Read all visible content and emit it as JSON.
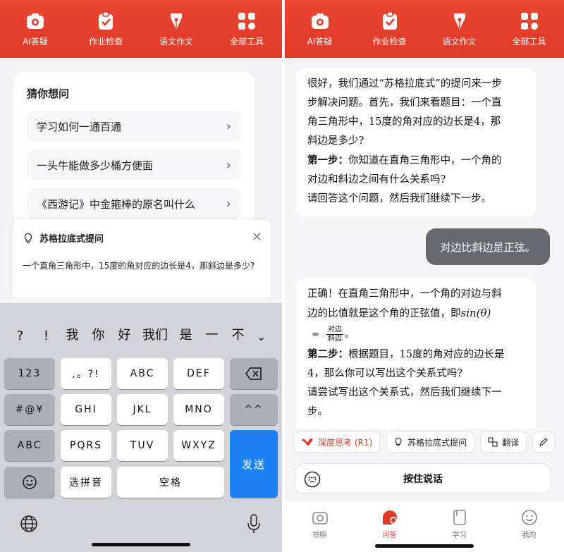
{
  "toolbar": {
    "items": [
      "AI答疑",
      "作业检查",
      "语文作文",
      "全部工具"
    ]
  },
  "left": {
    "guess": {
      "title": "猜你想问",
      "questions": [
        "学习如何一通百通",
        "一头牛能做多少桶方便面",
        "《西游记》中金箍棒的原名叫什么"
      ]
    },
    "socratic_card": {
      "title": "苏格拉底式提问",
      "close": "✕",
      "text": "一个直角三角形中，15度的角对应的边长是4，那斜边是多少?"
    },
    "keyboard": {
      "candidates": [
        "?",
        "!",
        "我",
        "你",
        "好",
        "我们",
        "是",
        "一",
        "不"
      ],
      "row1": [
        ",。?!",
        "ABC",
        "DEF"
      ],
      "row2": [
        "GHI",
        "JKL",
        "MNO"
      ],
      "row3": [
        "PQRS",
        "TUV",
        "WXYZ"
      ],
      "k123": "123",
      "sym": "#@¥",
      "abc": "ABC",
      "face": "^^",
      "pinyin": "选拼音",
      "space": "空格",
      "send": "发送"
    }
  },
  "right": {
    "msg1": {
      "l1": "很好，我们通过“苏格拉底式”的提问来一步",
      "l2": "步解决问题。首先，我们来看题目：一个直",
      "l3": "角三角形中，15度的角对应的边长是4，那",
      "l4": "斜边是多少?",
      "step_label": "第一步：",
      "l5": "你知道在直角三角形中，一个角的",
      "l6": "对边和斜边之间有什么关系吗?",
      "l7": "请回答这个问题，然后我们继续下一步。"
    },
    "user_msg": "对边比斜边是正弦。",
    "msg2": {
      "l1": "正确！在直角三角形中，一个角的对边与斜",
      "l2": "边的比值就是这个角的正弦值，即",
      "math": "sin(θ)",
      "eq": "=",
      "num": "对边",
      "den": "斜边",
      "end": "。",
      "step_label": "第二步：",
      "l3": "根据题目，15度的角对应的边长是",
      "l4": "4，那么你可以写出这个关系式吗?",
      "l5": "请尝试写出这个关系式，然后我们继续下一",
      "l6": "步。"
    },
    "chips": [
      "深度思考 (R1)",
      "苏格拉底式提问",
      "翻译"
    ],
    "voice": "按住说话",
    "nav": [
      "拍照",
      "问答",
      "学习",
      "我的"
    ],
    "colors": {
      "accent": "#e23a28"
    }
  }
}
